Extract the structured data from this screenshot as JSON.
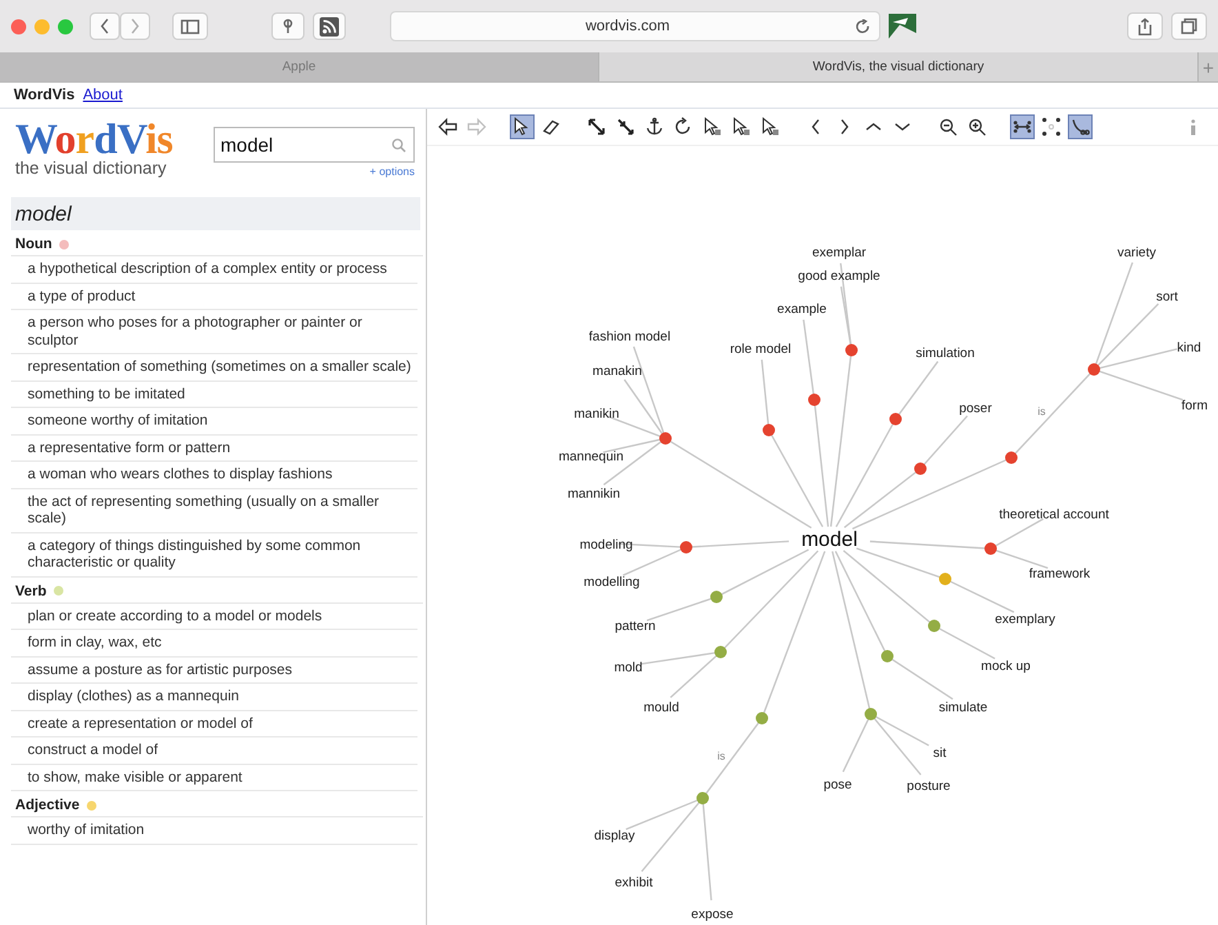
{
  "browser": {
    "url": "wordvis.com",
    "tabs": [
      {
        "label": "Apple",
        "selected": false
      },
      {
        "label": "WordVis, the visual dictionary",
        "selected": true
      }
    ],
    "new_tab": "+"
  },
  "site_nav": {
    "brand": "WordVis",
    "links": [
      "About"
    ]
  },
  "logo": {
    "name": "WordVis",
    "tagline": "the visual dictionary"
  },
  "search": {
    "value": "model",
    "options_link": "+ options"
  },
  "headword": "model",
  "parts_of_speech": [
    {
      "label": "Noun",
      "color": "#f4bcbc",
      "senses": [
        "a hypothetical description of a complex entity or process",
        "a type of product",
        "a person who poses for a photographer or painter or sculptor",
        "representation of something (sometimes on a smaller scale)",
        "something to be imitated",
        "someone worthy of imitation",
        "a representative form or pattern",
        "a woman who wears clothes to display fashions",
        "the act of representing something (usually on a smaller scale)",
        "a category of things distinguished by some common characteristic or quality"
      ]
    },
    {
      "label": "Verb",
      "color": "#d9e5a3",
      "senses": [
        "plan or create according to a model or models",
        "form in clay, wax, etc",
        "assume a posture as for artistic purposes",
        "display (clothes) as a mannequin",
        "create a representation or model of",
        "construct a model of",
        "to show, make visible or apparent"
      ]
    },
    {
      "label": "Adjective",
      "color": "#f7d66e",
      "senses": [
        "worthy of imitation"
      ]
    }
  ],
  "toolbar": [
    {
      "selected": false,
      "disabled": false
    },
    {
      "selected": false,
      "disabled": true
    },
    {
      "selected": true,
      "disabled": false
    },
    {
      "selected": false,
      "disabled": false
    },
    {
      "selected": false,
      "disabled": false
    },
    {
      "selected": false,
      "disabled": false
    },
    {
      "selected": false,
      "disabled": false
    },
    {
      "selected": false,
      "disabled": false
    },
    {
      "selected": false,
      "disabled": false
    },
    {
      "selected": false,
      "disabled": false
    },
    {
      "selected": false,
      "disabled": false
    },
    {
      "selected": false,
      "disabled": false
    },
    {
      "selected": false,
      "disabled": false
    },
    {
      "selected": false,
      "disabled": false
    },
    {
      "selected": false,
      "disabled": false
    },
    {
      "selected": false,
      "disabled": false
    },
    {
      "selected": false,
      "disabled": false
    },
    {
      "selected": true,
      "disabled": false
    },
    {
      "selected": false,
      "disabled": false
    },
    {
      "selected": true,
      "disabled": false
    },
    {
      "selected": false,
      "disabled": false
    }
  ],
  "graph": {
    "center": "model",
    "senses": [
      {
        "color": "#e5432f",
        "words": [
          "fashion model",
          "manakin",
          "manikin",
          "mannequin",
          "mannikin"
        ]
      },
      {
        "color": "#e5432f",
        "words": [
          "role model"
        ]
      },
      {
        "color": "#e5432f",
        "words": [
          "example"
        ]
      },
      {
        "color": "#e5432f",
        "words": [
          "exemplar",
          "good example"
        ]
      },
      {
        "color": "#e5432f",
        "words": [
          "simulation"
        ]
      },
      {
        "color": "#e5432f",
        "words": [
          "poser"
        ]
      },
      {
        "color": "#e5432f",
        "relation": "is",
        "words": [
          "variety",
          "sort",
          "kind",
          "form"
        ]
      },
      {
        "color": "#e5432f",
        "words": [
          "modeling",
          "modelling"
        ]
      },
      {
        "color": "#e5432f",
        "words": [
          "theoretical account",
          "framework"
        ]
      },
      {
        "color": "#e2b01c",
        "words": [
          "exemplary"
        ]
      },
      {
        "color": "#94ad45",
        "words": [
          "pattern"
        ]
      },
      {
        "color": "#94ad45",
        "words": [
          "mold",
          "mould"
        ]
      },
      {
        "color": "#94ad45",
        "relation": "is",
        "words": [
          "display",
          "exhibit",
          "expose"
        ]
      },
      {
        "color": "#94ad45",
        "words": [
          "pose",
          "sit",
          "posture"
        ]
      },
      {
        "color": "#94ad45",
        "words": [
          "simulate"
        ]
      },
      {
        "color": "#94ad45",
        "words": [
          "mock up"
        ]
      }
    ]
  }
}
